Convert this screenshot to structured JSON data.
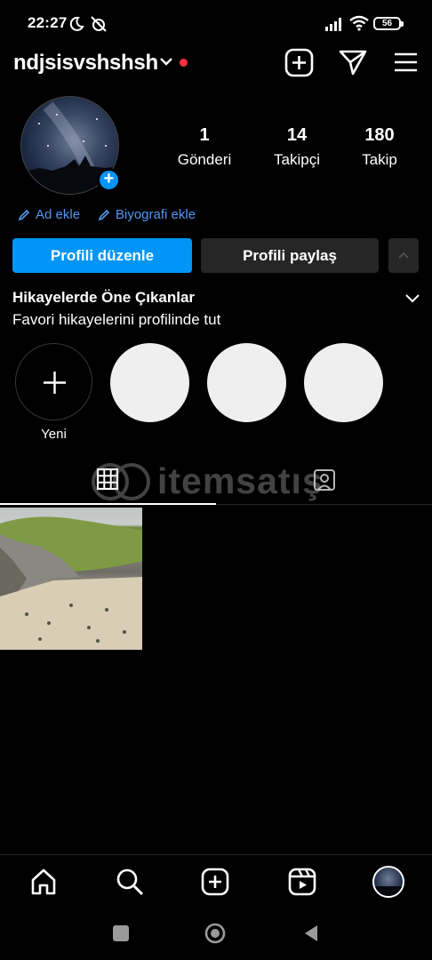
{
  "status_bar": {
    "time": "22:27",
    "battery": "56"
  },
  "header": {
    "username": "ndjsisvshshsh"
  },
  "stats": [
    {
      "value": "1",
      "label": "Gönderi"
    },
    {
      "value": "14",
      "label": "Takipçi"
    },
    {
      "value": "180",
      "label": "Takip"
    }
  ],
  "links": {
    "add_name": "Ad ekle",
    "add_bio": "Biyografi ekle"
  },
  "buttons": {
    "edit_profile": "Profili düzenle",
    "share_profile": "Profili paylaş"
  },
  "highlights": {
    "title": "Hikayelerde Öne Çıkanlar",
    "subtitle": "Favori hikayelerini profilinde tut",
    "new_label": "Yeni"
  },
  "watermark": "itemsatış",
  "colors": {
    "accent": "#0095f6",
    "link": "#4f97f2",
    "notification_dot": "#ff3040",
    "background": "#000000"
  }
}
